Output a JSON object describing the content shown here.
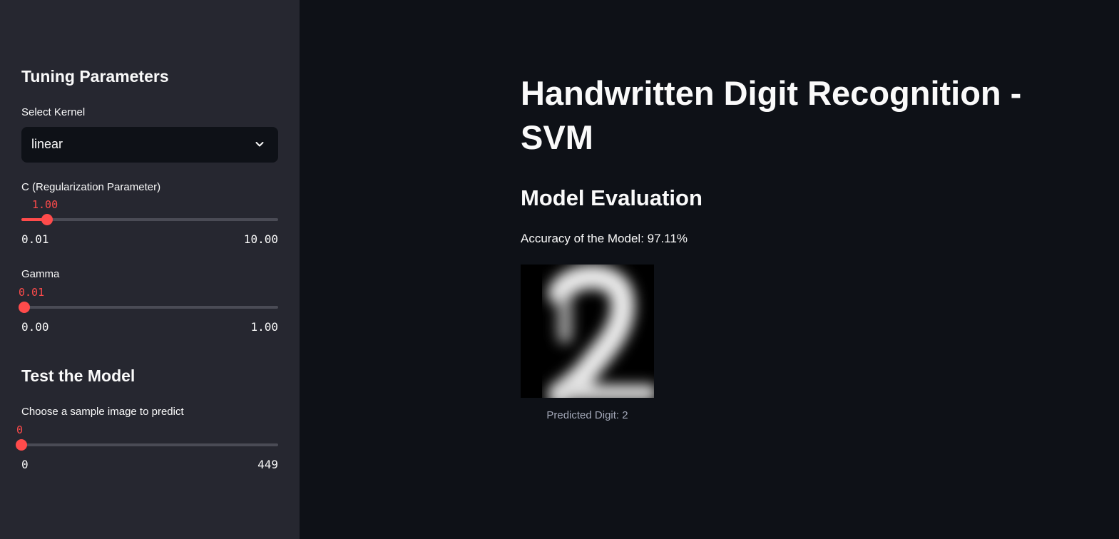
{
  "sidebar": {
    "tuning_heading": "Tuning Parameters",
    "kernel": {
      "label": "Select Kernel",
      "value": "linear"
    },
    "c_slider": {
      "label": "C (Regularization Parameter)",
      "value": "1.00",
      "min": "0.01",
      "max": "10.00"
    },
    "gamma_slider": {
      "label": "Gamma",
      "value": "0.01",
      "min": "0.00",
      "max": "1.00"
    },
    "test_heading": "Test the Model",
    "sample_slider": {
      "label": "Choose a sample image to predict",
      "value": "0",
      "min": "0",
      "max": "449"
    }
  },
  "main": {
    "title": "Handwritten Digit Recognition - SVM",
    "section_heading": "Model Evaluation",
    "accuracy_text": "Accuracy of the Model: 97.11%",
    "caption": "Predicted Digit: 2"
  },
  "colors": {
    "accent": "#ff4b4b",
    "sidebar_bg": "#262730",
    "main_bg": "#0e1117",
    "text": "#fafafa"
  },
  "icons": {
    "select_chevron": "chevron-down-icon"
  }
}
